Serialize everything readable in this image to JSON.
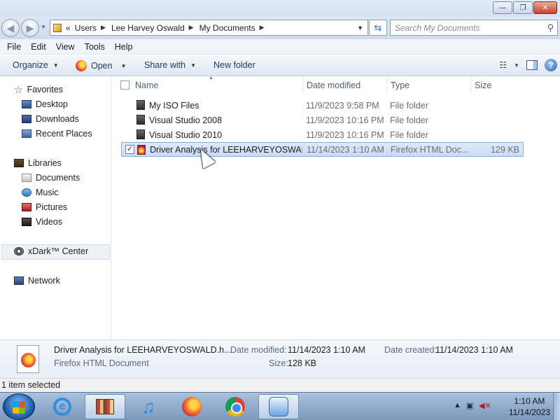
{
  "window": {
    "controls": {
      "minimize": "—",
      "maximize": "❐",
      "close": "✕"
    }
  },
  "address": {
    "overflow": "«",
    "crumbs": [
      "Users",
      "Lee Harvey Oswald",
      "My Documents"
    ],
    "separator": "▶",
    "search_placeholder": "Search My Documents"
  },
  "menu": [
    "File",
    "Edit",
    "View",
    "Tools",
    "Help"
  ],
  "toolbar": {
    "organize": "Organize",
    "open": "Open",
    "share_with": "Share with",
    "new_folder": "New folder"
  },
  "nav": {
    "favorites": {
      "label": "Favorites",
      "items": [
        "Desktop",
        "Downloads",
        "Recent Places"
      ]
    },
    "libraries": {
      "label": "Libraries",
      "items": [
        "Documents",
        "Music",
        "Pictures",
        "Videos"
      ]
    },
    "xdark": "xDark™ Center",
    "network": "Network"
  },
  "columns": {
    "name": "Name",
    "date": "Date modified",
    "type": "Type",
    "size": "Size"
  },
  "files": [
    {
      "name": "My ISO Files",
      "date": "11/9/2023 9:58 PM",
      "type": "File folder",
      "size": ""
    },
    {
      "name": "Visual Studio 2008",
      "date": "11/9/2023 10:16 PM",
      "type": "File folder",
      "size": ""
    },
    {
      "name": "Visual Studio 2010",
      "date": "11/9/2023 10:16 PM",
      "type": "File folder",
      "size": ""
    },
    {
      "name": "Driver Analysis for LEEHARVEYOSWAL...",
      "date": "11/14/2023 1:10 AM",
      "type": "Firefox HTML Doc...",
      "size": "129 KB",
      "selected": true
    }
  ],
  "details": {
    "name": "Driver Analysis for LEEHARVEYOSWALD.h...",
    "kind": "Firefox HTML Document",
    "modified_label": "Date modified:",
    "modified": "11/14/2023 1:10 AM",
    "created_label": "Date created:",
    "created": "11/14/2023 1:10 AM",
    "size_label": "Size:",
    "size": "128 KB"
  },
  "status": "1 item selected",
  "taskbar": {
    "time": "1:10 AM",
    "date": "11/14/2023"
  }
}
